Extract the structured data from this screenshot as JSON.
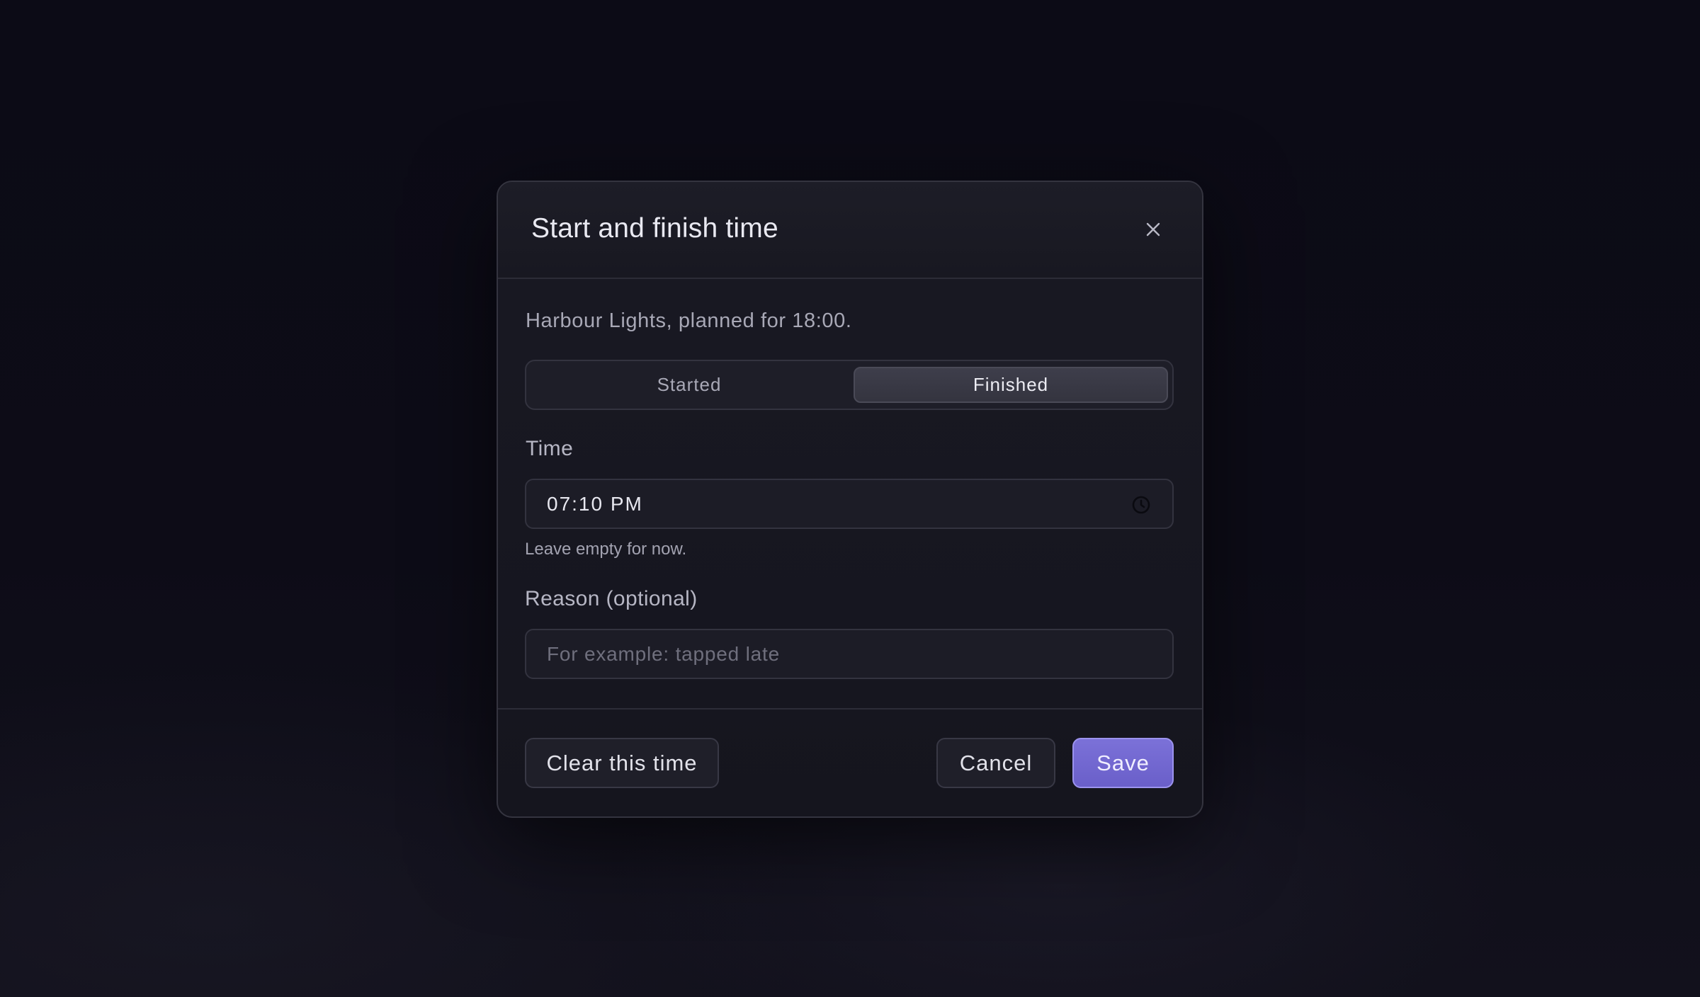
{
  "dialog": {
    "title": "Start and finish time",
    "close_icon": "close-icon",
    "subtitle": "Harbour Lights, planned for 18:00.",
    "segments": [
      {
        "label": "Started",
        "selected": false
      },
      {
        "label": "Finished",
        "selected": true
      }
    ],
    "time": {
      "label": "Time",
      "value": "07:10 PM",
      "icon": "clock-icon",
      "helper": "Leave empty for now."
    },
    "reason": {
      "label": "Reason (optional)",
      "value": "",
      "placeholder": "For example: tapped late"
    },
    "footer": {
      "clear_label": "Clear this time",
      "cancel_label": "Cancel",
      "save_label": "Save"
    }
  },
  "colors": {
    "accent": "#6f64d0",
    "background": "#0d0c17",
    "dialog": "#17171f"
  }
}
